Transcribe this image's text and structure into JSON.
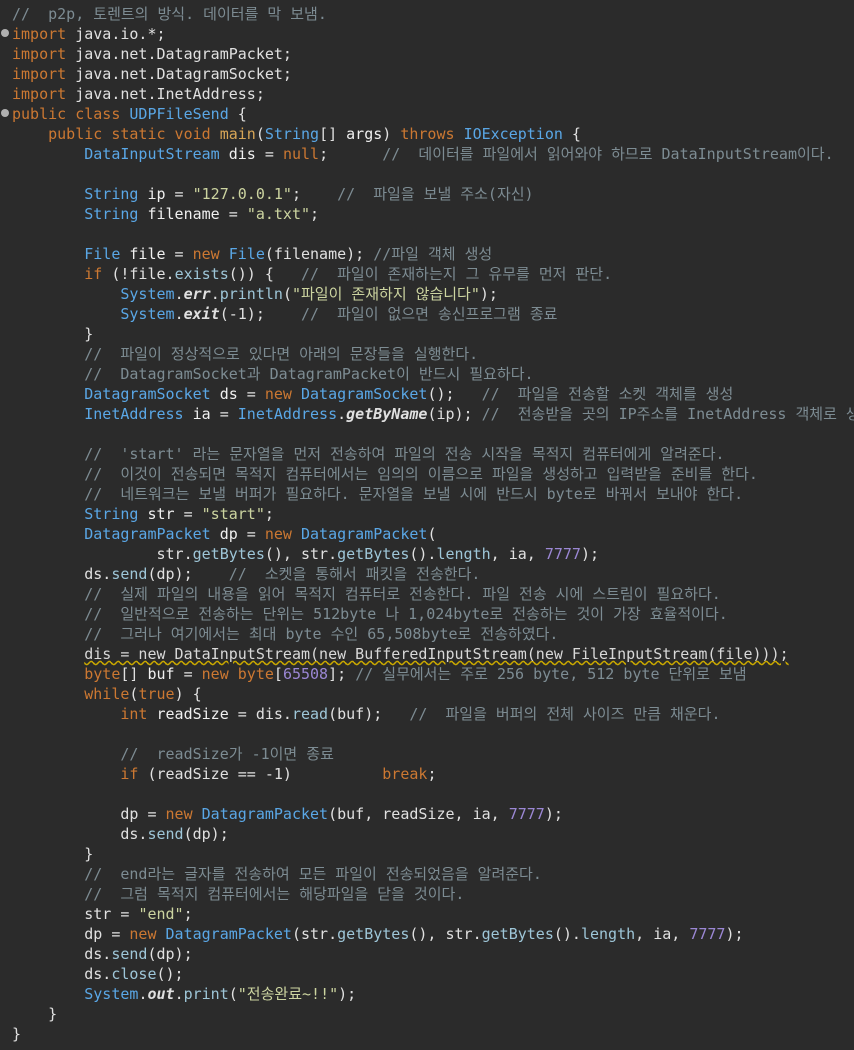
{
  "editor": {
    "file_class": "UDPFileSend",
    "lines": [
      [
        [
          "c",
          "//  p2p, 토렌트의 방식. 데이터를 막 보냄."
        ]
      ],
      [
        [
          "k",
          "import"
        ],
        [
          "p",
          " java.io.*;"
        ]
      ],
      [
        [
          "k",
          "import"
        ],
        [
          "p",
          " java.net.DatagramPacket;"
        ]
      ],
      [
        [
          "k",
          "import"
        ],
        [
          "p",
          " java.net.DatagramSocket;"
        ]
      ],
      [
        [
          "k",
          "import"
        ],
        [
          "p",
          " java.net.InetAddress;"
        ]
      ],
      [
        [
          "k",
          "public class "
        ],
        [
          "t",
          "UDPFileSend"
        ],
        [
          "p",
          " {"
        ]
      ],
      [
        [
          "p",
          "    "
        ],
        [
          "k",
          "public static void "
        ],
        [
          "f",
          "main"
        ],
        [
          "p",
          "("
        ],
        [
          "t",
          "String"
        ],
        [
          "p",
          "[] "
        ],
        [
          "v",
          "args"
        ],
        [
          "p",
          ") "
        ],
        [
          "k",
          "throws "
        ],
        [
          "t",
          "IOException"
        ],
        [
          "p",
          " {"
        ]
      ],
      [
        [
          "p",
          "        "
        ],
        [
          "t",
          "DataInputStream"
        ],
        [
          "p",
          " "
        ],
        [
          "v",
          "dis"
        ],
        [
          "p",
          " = "
        ],
        [
          "k",
          "null"
        ],
        [
          "p",
          ";      "
        ],
        [
          "c",
          "//  데이터를 파일에서 읽어와야 하므로 DataInputStream이다."
        ]
      ],
      [],
      [
        [
          "p",
          "        "
        ],
        [
          "t",
          "String"
        ],
        [
          "p",
          " "
        ],
        [
          "v",
          "ip"
        ],
        [
          "p",
          " = "
        ],
        [
          "s",
          "\"127.0.0.1\""
        ],
        [
          "p",
          ";    "
        ],
        [
          "c",
          "//  파일을 보낼 주소(자신)"
        ]
      ],
      [
        [
          "p",
          "        "
        ],
        [
          "t",
          "String"
        ],
        [
          "p",
          " "
        ],
        [
          "v",
          "filename"
        ],
        [
          "p",
          " = "
        ],
        [
          "s",
          "\"a.txt\""
        ],
        [
          "p",
          ";"
        ]
      ],
      [],
      [
        [
          "p",
          "        "
        ],
        [
          "t",
          "File"
        ],
        [
          "p",
          " "
        ],
        [
          "v",
          "file"
        ],
        [
          "p",
          " = "
        ],
        [
          "k",
          "new "
        ],
        [
          "t",
          "File"
        ],
        [
          "p",
          "(filename); "
        ],
        [
          "c",
          "//파일 객체 생성"
        ]
      ],
      [
        [
          "p",
          "        "
        ],
        [
          "k",
          "if "
        ],
        [
          "p",
          "(!file."
        ],
        [
          "m",
          "exists"
        ],
        [
          "p",
          "()) {   "
        ],
        [
          "c",
          "//  파일이 존재하는지 그 유무를 먼저 판단."
        ]
      ],
      [
        [
          "p",
          "            "
        ],
        [
          "t",
          "System"
        ],
        [
          "p",
          "."
        ],
        [
          "i",
          "err"
        ],
        [
          "p",
          "."
        ],
        [
          "m",
          "println"
        ],
        [
          "p",
          "("
        ],
        [
          "s",
          "\"파일이 존재하지 않습니다\""
        ],
        [
          "p",
          ");"
        ]
      ],
      [
        [
          "p",
          "            "
        ],
        [
          "t",
          "System"
        ],
        [
          "p",
          "."
        ],
        [
          "i",
          "exit"
        ],
        [
          "p",
          "(-1);    "
        ],
        [
          "c",
          "//  파일이 없으면 송신프로그램 종료"
        ]
      ],
      [
        [
          "p",
          "        }"
        ]
      ],
      [
        [
          "p",
          "        "
        ],
        [
          "c",
          "//  파일이 정상적으로 있다면 아래의 문장들을 실행한다."
        ]
      ],
      [
        [
          "p",
          "        "
        ],
        [
          "c",
          "//  DatagramSocket과 DatagramPacket이 반드시 필요하다."
        ]
      ],
      [
        [
          "p",
          "        "
        ],
        [
          "t",
          "DatagramSocket"
        ],
        [
          "p",
          " "
        ],
        [
          "v",
          "ds"
        ],
        [
          "p",
          " = "
        ],
        [
          "k",
          "new "
        ],
        [
          "t",
          "DatagramSocket"
        ],
        [
          "p",
          "();   "
        ],
        [
          "c",
          "//  파일을 전송할 소켓 객체를 생성"
        ]
      ],
      [
        [
          "p",
          "        "
        ],
        [
          "t",
          "InetAddress"
        ],
        [
          "p",
          " "
        ],
        [
          "v",
          "ia"
        ],
        [
          "p",
          " = "
        ],
        [
          "t",
          "InetAddress"
        ],
        [
          "p",
          "."
        ],
        [
          "i",
          "getByName"
        ],
        [
          "p",
          "(ip); "
        ],
        [
          "c",
          "//  전송받을 곳의 IP주소를 InetAddress 객체로 생성"
        ]
      ],
      [],
      [
        [
          "p",
          "        "
        ],
        [
          "c",
          "//  'start' 라는 문자열을 먼저 전송하여 파일의 전송 시작을 목적지 컴퓨터에게 알려준다."
        ]
      ],
      [
        [
          "p",
          "        "
        ],
        [
          "c",
          "//  이것이 전송되면 목적지 컴퓨터에서는 임의의 이름으로 파일을 생성하고 입력받을 준비를 한다."
        ]
      ],
      [
        [
          "p",
          "        "
        ],
        [
          "c",
          "//  네트워크는 보낼 버퍼가 필요하다. 문자열을 보낼 시에 반드시 byte로 바꿔서 보내야 한다."
        ]
      ],
      [
        [
          "p",
          "        "
        ],
        [
          "t",
          "String"
        ],
        [
          "p",
          " "
        ],
        [
          "v",
          "str"
        ],
        [
          "p",
          " = "
        ],
        [
          "s",
          "\"start\""
        ],
        [
          "p",
          ";"
        ]
      ],
      [
        [
          "p",
          "        "
        ],
        [
          "t",
          "DatagramPacket"
        ],
        [
          "p",
          " "
        ],
        [
          "v",
          "dp"
        ],
        [
          "p",
          " = "
        ],
        [
          "k",
          "new "
        ],
        [
          "t",
          "DatagramPacket"
        ],
        [
          "p",
          "("
        ]
      ],
      [
        [
          "p",
          "                str."
        ],
        [
          "m",
          "getBytes"
        ],
        [
          "p",
          "(), str."
        ],
        [
          "m",
          "getBytes"
        ],
        [
          "p",
          "()."
        ],
        [
          "m",
          "length"
        ],
        [
          "p",
          ", ia, "
        ],
        [
          "n",
          "7777"
        ],
        [
          "p",
          ");"
        ]
      ],
      [
        [
          "p",
          "        ds."
        ],
        [
          "m",
          "send"
        ],
        [
          "p",
          "(dp);    "
        ],
        [
          "c",
          "//  소켓을 통해서 패킷을 전송한다."
        ]
      ],
      [
        [
          "p",
          "        "
        ],
        [
          "c",
          "//  실제 파일의 내용을 읽어 목적지 컴퓨터로 전송한다. 파일 전송 시에 스트림이 필요하다."
        ]
      ],
      [
        [
          "p",
          "        "
        ],
        [
          "c",
          "//  일반적으로 전송하는 단위는 512byte 나 1,024byte로 전송하는 것이 가장 효율적이다."
        ]
      ],
      [
        [
          "p",
          "        "
        ],
        [
          "c",
          "//  그러나 여기에서는 최대 byte 수인 65,508byte로 전송하였다."
        ]
      ],
      [
        [
          "p",
          "        "
        ],
        [
          "w",
          "dis = new DataInputStream(new BufferedInputStream(new FileInputStream(file)));"
        ]
      ],
      [
        [
          "p",
          "        "
        ],
        [
          "k",
          "byte"
        ],
        [
          "p",
          "[] "
        ],
        [
          "v",
          "buf"
        ],
        [
          "p",
          " = "
        ],
        [
          "k",
          "new byte"
        ],
        [
          "p",
          "["
        ],
        [
          "n",
          "65508"
        ],
        [
          "p",
          "]; "
        ],
        [
          "c",
          "// 실무에서는 주로 256 byte, 512 byte 단위로 보냄"
        ]
      ],
      [
        [
          "p",
          "        "
        ],
        [
          "k",
          "while"
        ],
        [
          "p",
          "("
        ],
        [
          "k",
          "true"
        ],
        [
          "p",
          ") {"
        ]
      ],
      [
        [
          "p",
          "            "
        ],
        [
          "k",
          "int "
        ],
        [
          "v",
          "readSize"
        ],
        [
          "p",
          " = dis."
        ],
        [
          "m",
          "read"
        ],
        [
          "p",
          "(buf);   "
        ],
        [
          "c",
          "//  파일을 버퍼의 전체 사이즈 만큼 채운다."
        ]
      ],
      [],
      [
        [
          "p",
          "            "
        ],
        [
          "c",
          "//  readSize가 -1이면 종료"
        ]
      ],
      [
        [
          "p",
          "            "
        ],
        [
          "k",
          "if "
        ],
        [
          "p",
          "(readSize == -1)          "
        ],
        [
          "k",
          "break"
        ],
        [
          "p",
          ";"
        ]
      ],
      [],
      [
        [
          "p",
          "            dp = "
        ],
        [
          "k",
          "new "
        ],
        [
          "t",
          "DatagramPacket"
        ],
        [
          "p",
          "(buf, readSize, ia, "
        ],
        [
          "n",
          "7777"
        ],
        [
          "p",
          ");"
        ]
      ],
      [
        [
          "p",
          "            ds."
        ],
        [
          "m",
          "send"
        ],
        [
          "p",
          "(dp);"
        ]
      ],
      [
        [
          "p",
          "        }"
        ]
      ],
      [
        [
          "p",
          "        "
        ],
        [
          "c",
          "//  end라는 글자를 전송하여 모든 파일이 전송되었음을 알려준다."
        ]
      ],
      [
        [
          "p",
          "        "
        ],
        [
          "c",
          "//  그럼 목적지 컴퓨터에서는 해당파일을 닫을 것이다."
        ]
      ],
      [
        [
          "p",
          "        str = "
        ],
        [
          "s",
          "\"end\""
        ],
        [
          "p",
          ";"
        ]
      ],
      [
        [
          "p",
          "        dp = "
        ],
        [
          "k",
          "new "
        ],
        [
          "t",
          "DatagramPacket"
        ],
        [
          "p",
          "(str."
        ],
        [
          "m",
          "getBytes"
        ],
        [
          "p",
          "(), str."
        ],
        [
          "m",
          "getBytes"
        ],
        [
          "p",
          "()."
        ],
        [
          "m",
          "length"
        ],
        [
          "p",
          ", ia, "
        ],
        [
          "n",
          "7777"
        ],
        [
          "p",
          ");"
        ]
      ],
      [
        [
          "p",
          "        ds."
        ],
        [
          "m",
          "send"
        ],
        [
          "p",
          "(dp);"
        ]
      ],
      [
        [
          "p",
          "        ds."
        ],
        [
          "m",
          "close"
        ],
        [
          "p",
          "();"
        ]
      ],
      [
        [
          "p",
          "        "
        ],
        [
          "t",
          "System"
        ],
        [
          "p",
          "."
        ],
        [
          "i",
          "out"
        ],
        [
          "p",
          "."
        ],
        [
          "m",
          "print"
        ],
        [
          "p",
          "("
        ],
        [
          "s",
          "\"전송완료~!!\""
        ],
        [
          "p",
          ");"
        ]
      ],
      [
        [
          "p",
          "    }"
        ]
      ],
      [
        [
          "p",
          "}"
        ]
      ]
    ]
  },
  "colors": {
    "background": "#2b2b2b",
    "keyword": "#cc7832",
    "type": "#5aa7e6",
    "comment": "#7d8c93",
    "string": "#ccd4a0",
    "number": "#9b87d4",
    "warning_underline": "#c9a800"
  },
  "gutter_markers": [
    {
      "line": 2,
      "icon": "fold-marker-icon"
    },
    {
      "line": 6,
      "icon": "fold-marker-icon"
    }
  ]
}
